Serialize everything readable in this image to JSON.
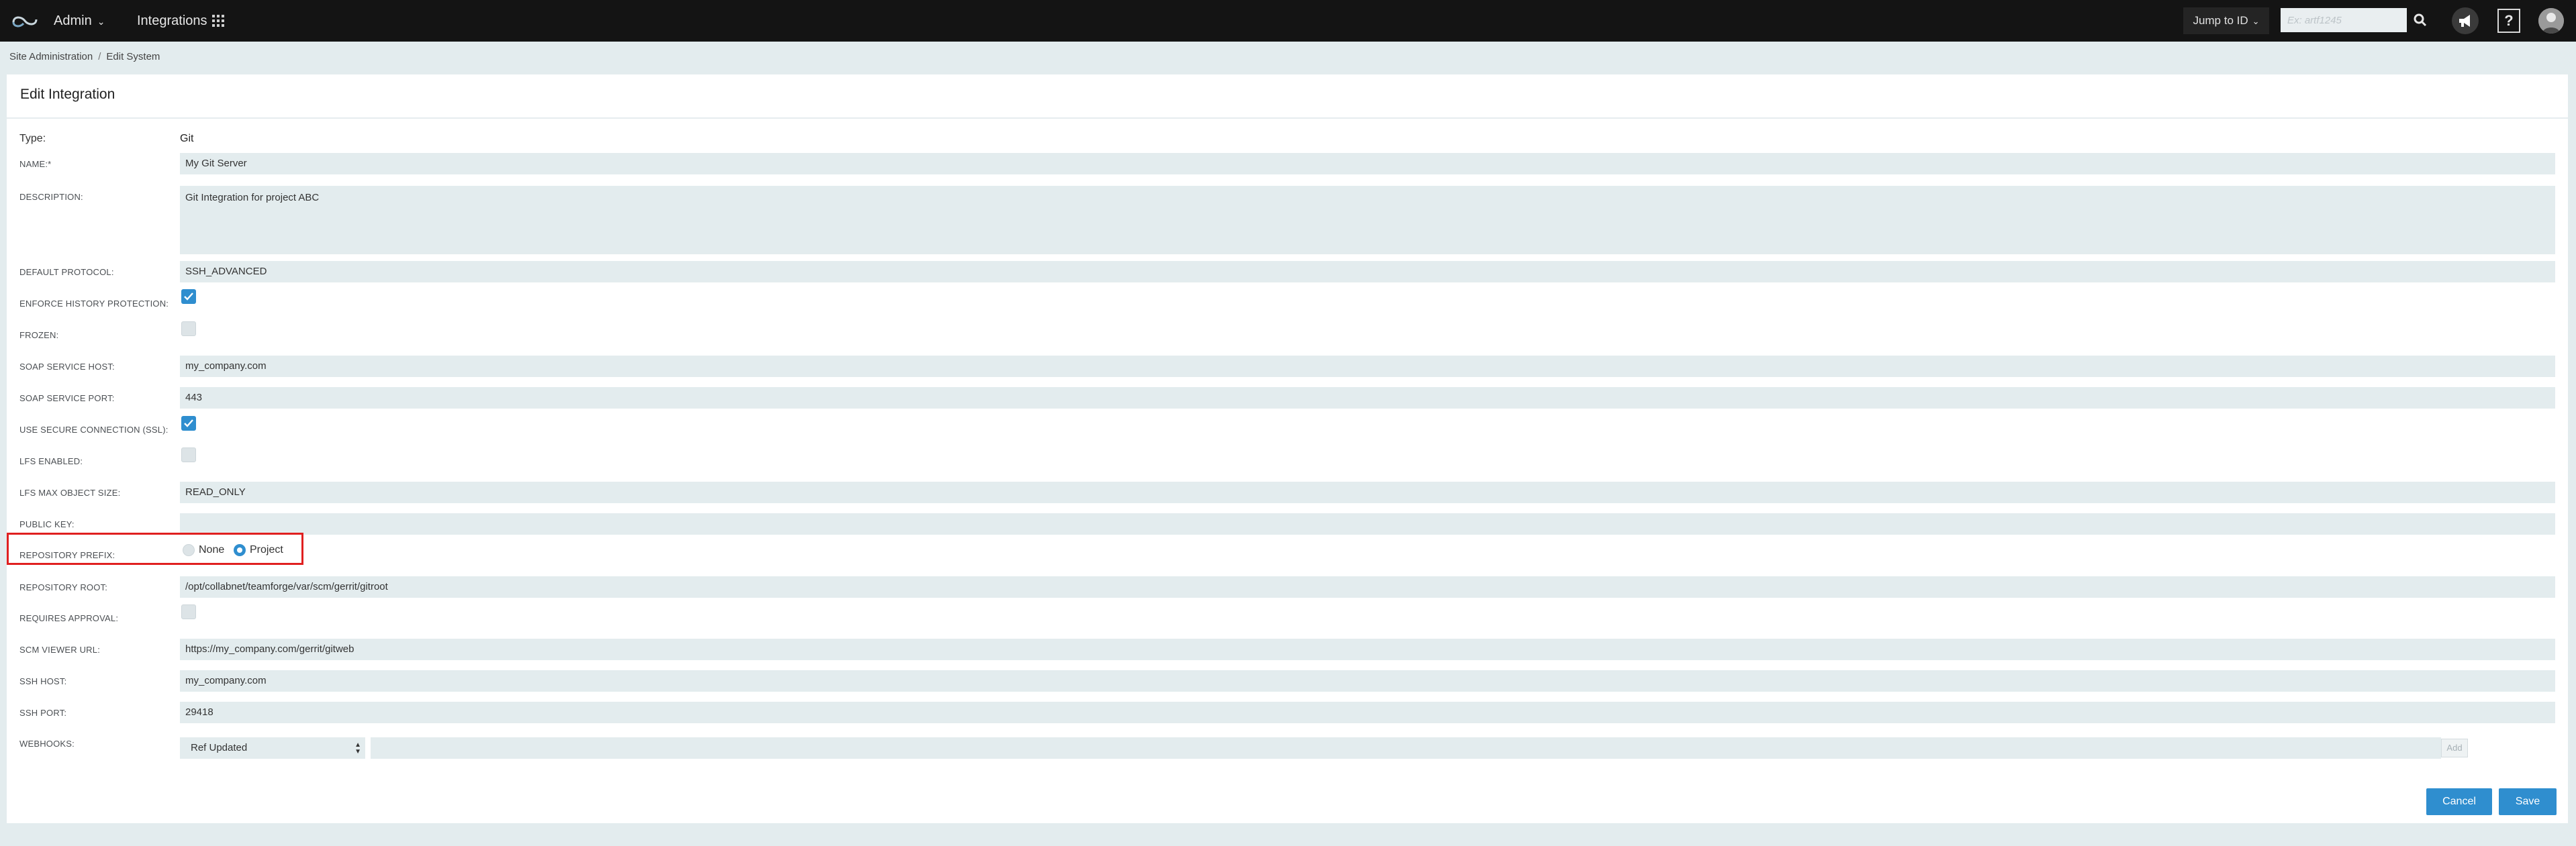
{
  "nav": {
    "admin_label": "Admin",
    "integrations_label": "Integrations",
    "jump_label": "Jump to ID",
    "jump_placeholder": "Ex: artf1245"
  },
  "breadcrumb": {
    "items": [
      "Site Administration",
      "Edit System"
    ]
  },
  "page": {
    "title": "Edit Integration"
  },
  "form": {
    "type_label": "Type:",
    "type_value": "Git",
    "name_label": "NAME:*",
    "name_value": "My Git Server",
    "description_label": "DESCRIPTION:",
    "description_value": "Git Integration for project ABC",
    "default_protocol_label": "DEFAULT PROTOCOL:",
    "default_protocol_value": "SSH_ADVANCED",
    "enforce_history_label": "ENFORCE HISTORY PROTECTION:",
    "enforce_history_checked": true,
    "frozen_label": "FROZEN:",
    "frozen_checked": false,
    "soap_host_label": "SOAP SERVICE HOST:",
    "soap_host_value": "my_company.com",
    "soap_port_label": "SOAP SERVICE PORT:",
    "soap_port_value": "443",
    "ssl_label": "USE SECURE CONNECTION (SSL):",
    "ssl_checked": true,
    "lfs_enabled_label": "LFS ENABLED:",
    "lfs_enabled_checked": false,
    "lfs_max_label": "LFS MAX OBJECT SIZE:",
    "lfs_max_value": "READ_ONLY",
    "public_key_label": "PUBLIC KEY:",
    "public_key_value": "",
    "repo_prefix_label": "REPOSITORY PREFIX:",
    "repo_prefix_options": [
      "None",
      "Project"
    ],
    "repo_prefix_selected": "Project",
    "repo_root_label": "REPOSITORY ROOT:",
    "repo_root_value": "/opt/collabnet/teamforge/var/scm/gerrit/gitroot",
    "requires_approval_label": "REQUIRES APPROVAL:",
    "requires_approval_checked": false,
    "scm_viewer_label": "SCM VIEWER URL:",
    "scm_viewer_value": "https://my_company.com/gerrit/gitweb",
    "ssh_host_label": "SSH HOST:",
    "ssh_host_value": "my_company.com",
    "ssh_port_label": "SSH PORT:",
    "ssh_port_value": "29418",
    "webhooks_label": "WEBHOOKS:",
    "webhooks_event": "Ref Updated",
    "webhooks_add_label": "Add"
  },
  "actions": {
    "cancel_label": "Cancel",
    "save_label": "Save"
  },
  "colors": {
    "nav_bg": "#141414",
    "accent": "#2f8ecf",
    "field_bg": "#e3ecee",
    "highlight": "#e02020"
  }
}
